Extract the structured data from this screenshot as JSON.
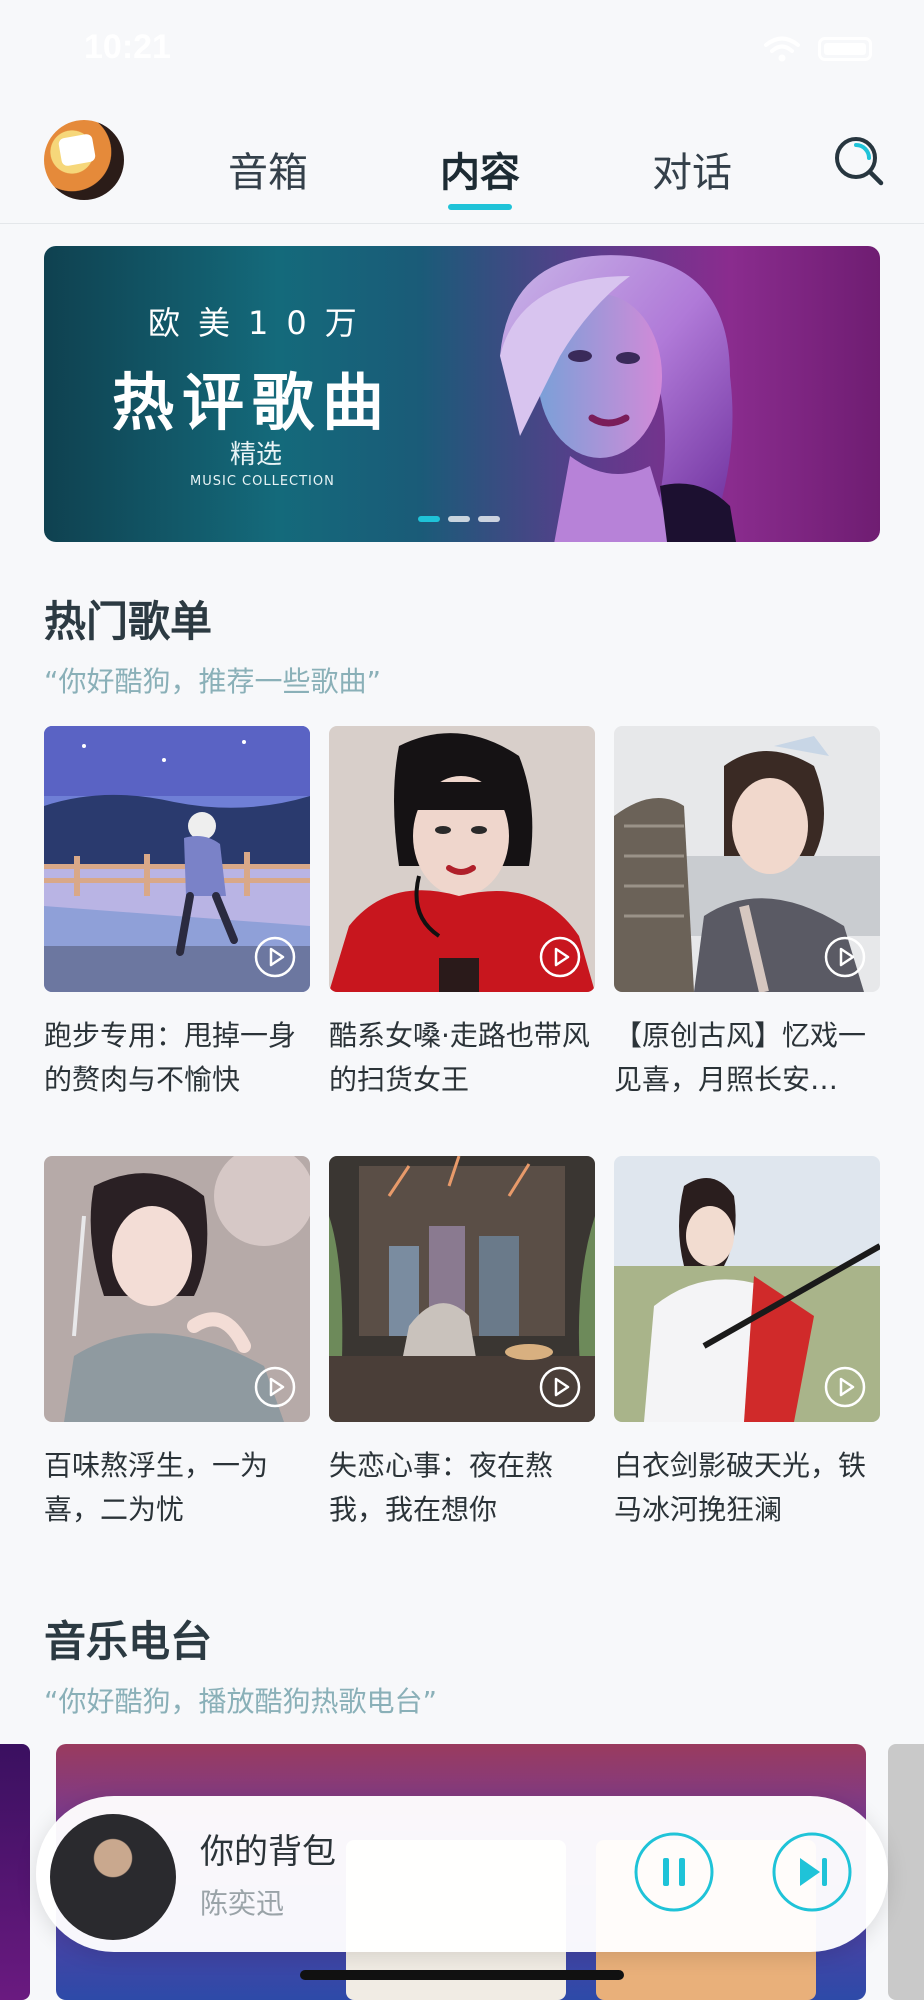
{
  "status": {
    "time": "10:21"
  },
  "nav": {
    "tabs": [
      {
        "label": "音箱"
      },
      {
        "label": "内容"
      },
      {
        "label": "对话"
      }
    ],
    "active_tab": "内容"
  },
  "banner": {
    "line1": "欧美10万",
    "line2": "热评歌曲",
    "line3": "精选",
    "line4": "MUSIC COLLECTION",
    "dots": 3,
    "active_dot": 1
  },
  "hot_playlists": {
    "title": "热门歌单",
    "subtitle": "“你好酷狗，推荐一些歌曲”",
    "items": [
      {
        "title": "跑步专用：甩掉一身的赘肉与不愉快"
      },
      {
        "title": "酷系女嗓·走路也带风的扫货女王"
      },
      {
        "title": "【原创古风】忆戏一见喜，月照长安…"
      },
      {
        "title": "百味熬浮生，一为喜，二为忧"
      },
      {
        "title": "失恋心事：夜在熬我，我在想你"
      },
      {
        "title": "白衣剑影破天光，铁马冰河挽狂澜"
      }
    ]
  },
  "radio": {
    "title": "音乐电台",
    "subtitle": "“你好酷狗，播放酷狗热歌电台”"
  },
  "player": {
    "song": "你的背包",
    "artist": "陈奕迅"
  },
  "colors": {
    "accent": "#1fc3d8",
    "background": "#f7f8fa"
  }
}
